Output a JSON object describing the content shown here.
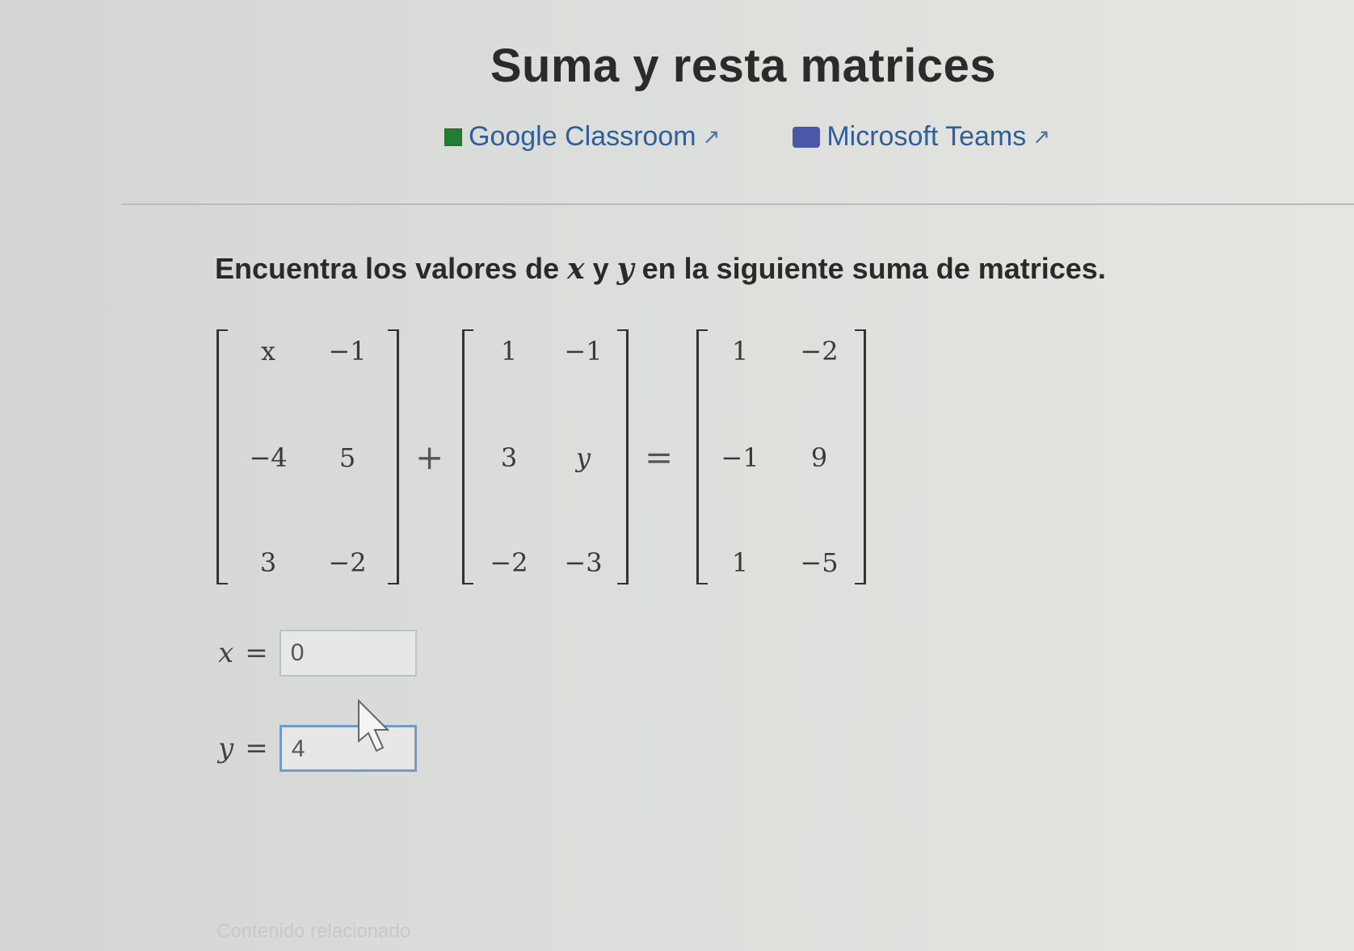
{
  "title": "Suma y resta matrices",
  "share": {
    "google_classroom": "Google Classroom",
    "microsoft_teams": "Microsoft Teams"
  },
  "question": {
    "prefix": "Encuentra los valores de ",
    "var_x": "x",
    "mid": " y ",
    "var_y": "y",
    "suffix": " en la siguiente suma de matrices."
  },
  "matrices": {
    "a": [
      [
        "x",
        "−1"
      ],
      [
        "−4",
        "5"
      ],
      [
        "3",
        "−2"
      ]
    ],
    "b": [
      [
        "1",
        "−1"
      ],
      [
        "3",
        "y"
      ],
      [
        "−2",
        "−3"
      ]
    ],
    "c": [
      [
        "1",
        "−2"
      ],
      [
        "−1",
        "9"
      ],
      [
        "1",
        "−5"
      ]
    ]
  },
  "operators": {
    "plus": "+",
    "equals": "="
  },
  "answers": {
    "x_label": "x",
    "x_value": "0",
    "y_label": "y",
    "y_value": "4"
  },
  "footer": {
    "related": "Contenido relacionado"
  }
}
